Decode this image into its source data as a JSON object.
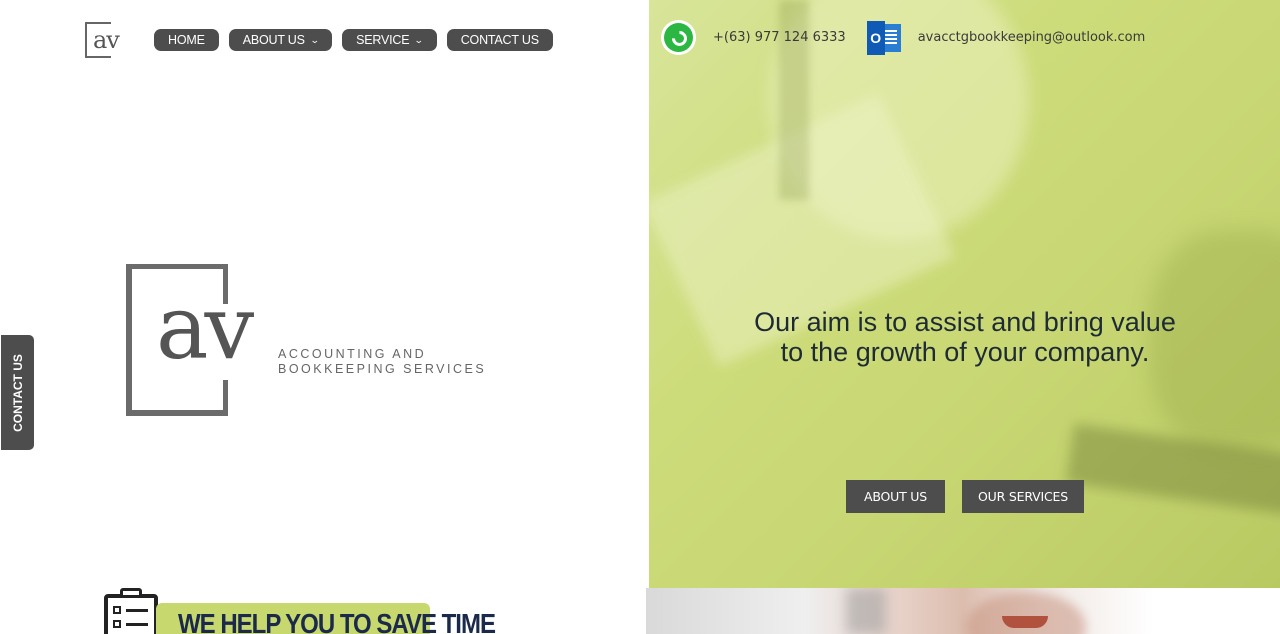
{
  "header": {
    "logo_text": "av",
    "nav": [
      {
        "label": "HOME",
        "has_dropdown": false
      },
      {
        "label": "ABOUT US",
        "has_dropdown": true
      },
      {
        "label": "SERVICE",
        "has_dropdown": true
      },
      {
        "label": "CONTACT US",
        "has_dropdown": false
      }
    ]
  },
  "contact": {
    "phone": "+(63) 977 124 6333",
    "email": "avacctgbookkeeping@outlook.com",
    "whatsapp_icon": "whatsapp-icon",
    "outlook_icon": "outlook-icon"
  },
  "brand": {
    "logo_mark": "av",
    "tagline_line1": "ACCOUNTING AND",
    "tagline_line2": "BOOKKEEPING SERVICES"
  },
  "side_tab": {
    "label": "CONTACT US"
  },
  "hero": {
    "headline": "Our aim is to assist and bring value to the growth of your company.",
    "buttons": [
      {
        "label": "ABOUT US"
      },
      {
        "label": "OUR SERVICES"
      }
    ]
  },
  "promo": {
    "text": "WE HELP YOU TO SAVE TIME",
    "icon": "clipboard-checklist-icon"
  },
  "colors": {
    "accent_green": "#c7d86f",
    "button_dark": "#4d4d4d",
    "hero_overlay": "#cddc7a",
    "promo_text": "#1b2a4a"
  }
}
